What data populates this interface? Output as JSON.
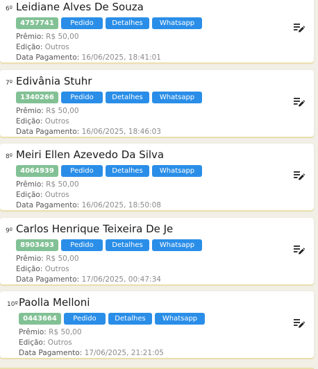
{
  "labels": {
    "premio": "Prêmio:",
    "edicao": "Edição:",
    "data_pagamento": "Data Pagamento:",
    "pedido": "Pedido",
    "detalhes": "Detalhes",
    "whatsapp": "Whatsapp"
  },
  "entries": [
    {
      "rank": "6º",
      "name": "Leidiane Alves De Souza",
      "code": "4757741",
      "premio": "R$ 50,00",
      "edicao": "Outros",
      "data_pagamento": "16/06/2025, 18:41:01"
    },
    {
      "rank": "7º",
      "name": "Edivânia Stuhr",
      "code": "1340266",
      "premio": "R$ 50,00",
      "edicao": "Outros",
      "data_pagamento": "16/06/2025, 18:46:03"
    },
    {
      "rank": "8º",
      "name": "Meiri Ellen Azevedo Da Silva",
      "code": "4064939",
      "premio": "R$ 50,00",
      "edicao": "Outros",
      "data_pagamento": "16/06/2025, 18:50:08"
    },
    {
      "rank": "9º",
      "name": "Carlos Henrique Teixeira De Je",
      "code": "8903493",
      "premio": "R$ 50,00",
      "edicao": "Outros",
      "data_pagamento": "17/06/2025, 00:47:34"
    },
    {
      "rank": "10º",
      "name": "Paolla Melloni",
      "code": "0443664",
      "premio": "R$ 50,00",
      "edicao": "Outros",
      "data_pagamento": "17/06/2025, 21:21:05"
    }
  ],
  "colors": {
    "code_badge": "#82c195",
    "action_button": "#2a8ee8",
    "card_shadow": "#eadfae"
  },
  "icons": {
    "edit": "edit-list-icon"
  }
}
